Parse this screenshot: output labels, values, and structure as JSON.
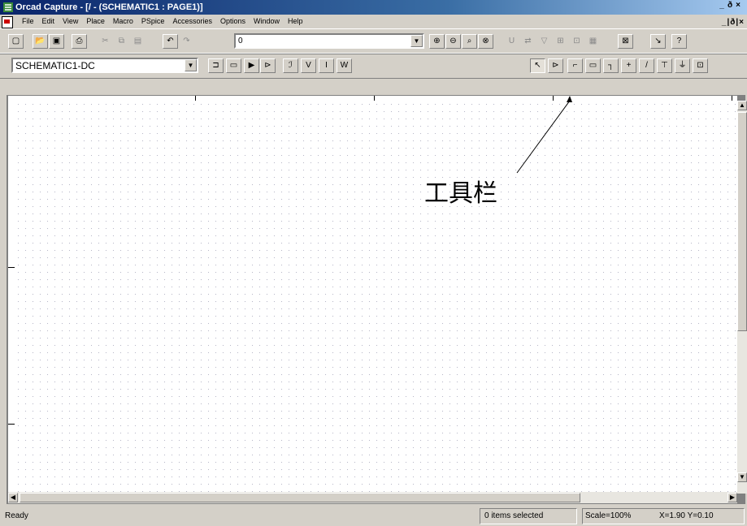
{
  "window": {
    "title": "Orcad Capture - [/ - (SCHEMATIC1 : PAGE1)]",
    "controls": [
      "_",
      "ð",
      "×"
    ]
  },
  "menubar": {
    "items": [
      "File",
      "Edit",
      "View",
      "Place",
      "Macro",
      "PSpice",
      "Accessories",
      "Options",
      "Window",
      "Help"
    ],
    "mdi_controls": "_|ð|×"
  },
  "toolbar1": {
    "part_combo_value": "0",
    "buttons": [
      {
        "name": "new-icon",
        "glyph": "▢"
      },
      {
        "name": "open-icon",
        "glyph": "📂"
      },
      {
        "name": "save-icon",
        "glyph": "▣"
      },
      {
        "name": "print-icon",
        "glyph": "⎙"
      },
      {
        "name": "cut-icon",
        "glyph": "✂"
      },
      {
        "name": "copy-icon",
        "glyph": "⧉"
      },
      {
        "name": "paste-icon",
        "glyph": "▤"
      },
      {
        "name": "undo-icon",
        "glyph": "↶"
      },
      {
        "name": "redo-icon",
        "glyph": "↷"
      },
      {
        "name": "zoom-in-icon",
        "glyph": "⊕"
      },
      {
        "name": "zoom-out-icon",
        "glyph": "⊖"
      },
      {
        "name": "zoom-area-icon",
        "glyph": "⌕"
      },
      {
        "name": "zoom-all-icon",
        "glyph": "⊗"
      },
      {
        "name": "annotate-icon",
        "glyph": "U"
      },
      {
        "name": "back-annotate-icon",
        "glyph": "⇄"
      },
      {
        "name": "drc-icon",
        "glyph": "▽"
      },
      {
        "name": "netlist-icon",
        "glyph": "⊞"
      },
      {
        "name": "crossref-icon",
        "glyph": "⊡"
      },
      {
        "name": "bom-icon",
        "glyph": "▦"
      },
      {
        "name": "snap-grid-icon",
        "glyph": "⊠"
      },
      {
        "name": "project-manager-icon",
        "glyph": "↘"
      },
      {
        "name": "help-icon",
        "glyph": "?"
      }
    ]
  },
  "toolbar2": {
    "profile_combo_value": "SCHEMATIC1-DC",
    "buttons": [
      {
        "name": "edit-sim-profile-icon",
        "glyph": "⊐"
      },
      {
        "name": "new-sim-profile-icon",
        "glyph": "▭"
      },
      {
        "name": "run-icon",
        "glyph": "▶"
      },
      {
        "name": "view-sim-results-icon",
        "glyph": "⊳"
      },
      {
        "name": "markers-icon",
        "glyph": "ℐ"
      },
      {
        "name": "voltage-marker-icon",
        "glyph": "V"
      },
      {
        "name": "current-marker-icon",
        "glyph": "I"
      },
      {
        "name": "power-marker-icon",
        "glyph": "W"
      },
      {
        "name": "select-tool-icon",
        "glyph": "↖"
      },
      {
        "name": "place-part-icon",
        "glyph": "⊳"
      },
      {
        "name": "place-wire-icon",
        "glyph": "⌐"
      },
      {
        "name": "place-net-alias-icon",
        "glyph": "▭"
      },
      {
        "name": "place-bus-icon",
        "glyph": "┐"
      },
      {
        "name": "place-junction-icon",
        "glyph": "+"
      },
      {
        "name": "place-bus-entry-icon",
        "glyph": "/"
      },
      {
        "name": "place-power-icon",
        "glyph": "⊤"
      },
      {
        "name": "place-ground-icon",
        "glyph": "⏚"
      },
      {
        "name": "place-hierarchical-block-icon",
        "glyph": "⊡"
      }
    ]
  },
  "annotation": {
    "label": "工具栏"
  },
  "statusbar": {
    "status": "Ready",
    "selection": "0 items selected",
    "scale": "Scale=100%",
    "coords": "X=1.90  Y=0.10"
  },
  "colors": {
    "titlebar_start": "#0a246a",
    "titlebar_end": "#a6caf0",
    "chrome": "#d4d0c8",
    "canvas": "#ffffff",
    "grid_dot": "#b8b8c8"
  }
}
